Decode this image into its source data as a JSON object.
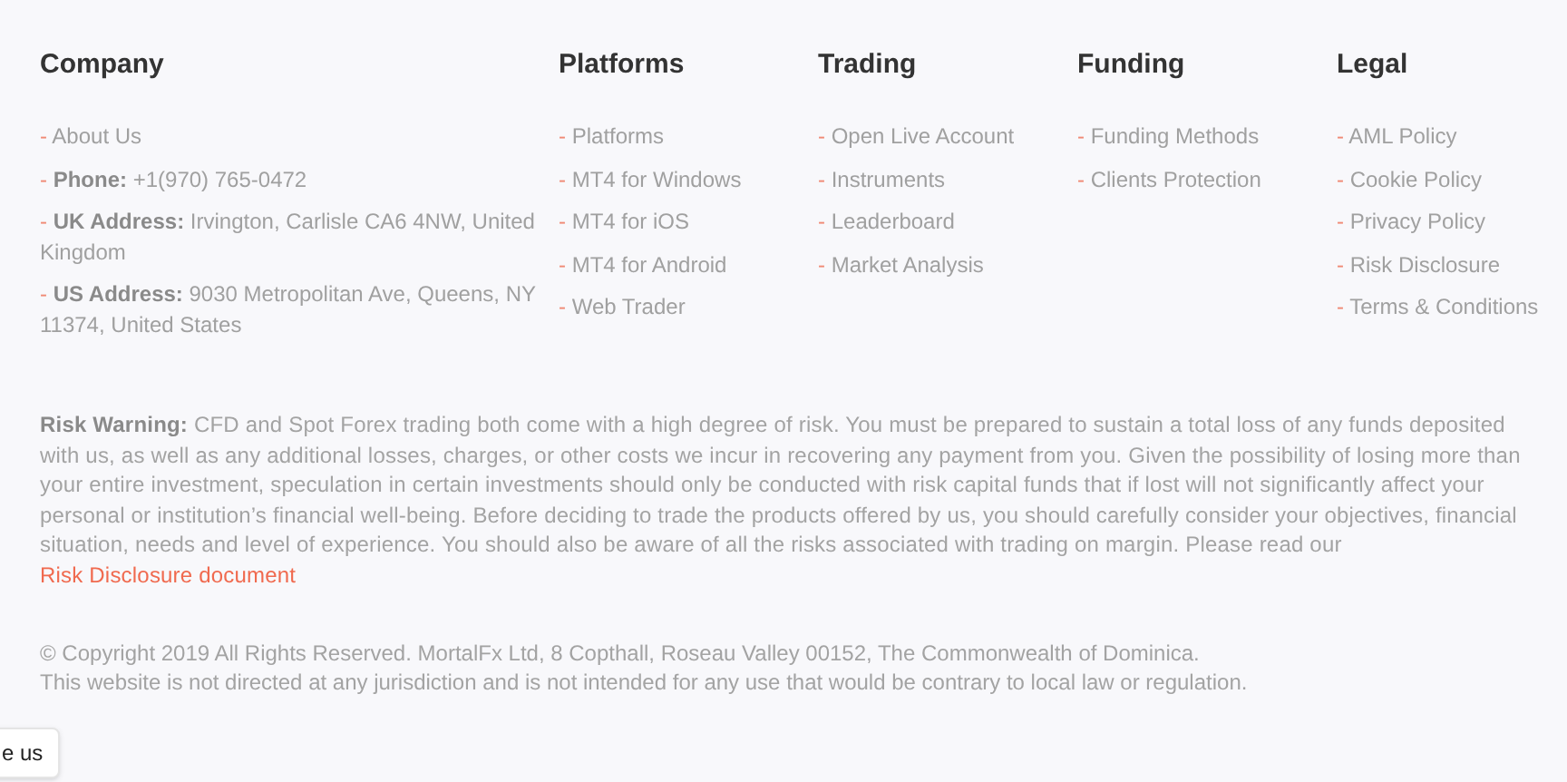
{
  "columns": [
    {
      "heading": "Company",
      "items": [
        {
          "marker": "-",
          "text": "About Us"
        },
        {
          "marker": "-",
          "text": "**Phone:** +1(970) 765-0472"
        },
        {
          "marker": "-",
          "text": "**UK Address:** Irvington, Carlisle CA6 4NW, United Kingdom"
        },
        {
          "marker": "-",
          "text": "**US Address:** 9030 Metropolitan Ave, Queens, NY 11374, United States"
        }
      ]
    },
    {
      "heading": "Platforms",
      "items": [
        {
          "marker": "-",
          "text": "Platforms"
        },
        {
          "marker": "-",
          "text": "MT4 for Windows"
        },
        {
          "marker": "-",
          "text": "MT4 for iOS"
        },
        {
          "marker": "-",
          "text": "MT4 for Android"
        },
        {
          "marker": "-",
          "text": "Web Trader"
        }
      ]
    },
    {
      "heading": "Trading",
      "items": [
        {
          "marker": "-",
          "text": "Open Live Account"
        },
        {
          "marker": "-",
          "text": "Instruments"
        },
        {
          "marker": "-",
          "text": "Leaderboard"
        },
        {
          "marker": "-",
          "text": "Market Analysis"
        }
      ]
    },
    {
      "heading": "Funding",
      "items": [
        {
          "marker": "-",
          "text": "Funding Methods"
        },
        {
          "marker": "-",
          "text": "Clients Protection"
        }
      ]
    },
    {
      "heading": "Legal",
      "items": [
        {
          "marker": "-",
          "text": "AML Policy"
        },
        {
          "marker": "-",
          "text": "Cookie Policy"
        },
        {
          "marker": "-",
          "text": "Privacy Policy"
        },
        {
          "marker": "-",
          "text": "Risk Disclosure"
        },
        {
          "marker": "-",
          "text": "Terms & Conditions"
        }
      ]
    }
  ],
  "risk_warning": {
    "text": "**Risk Warning:** CFD and Spot Forex trading both come with a high degree of risk. You must be prepared to sustain a total loss of any funds deposited with us, as well as any additional losses, charges, or other costs we incur in recovering any payment from you. Given the possibility of losing more than your entire investment, speculation in certain investments should only be conducted with risk capital funds that if lost will not significantly affect your personal or institution’s financial well-being. Before deciding to trade the products offered by us, you should carefully consider your objectives, financial situation, needs and level of experience. You should also be aware of all the risks associated with trading on margin. Please read our",
    "link": "Risk Disclosure document"
  },
  "copyright": [
    "© Copyright 2019 All Rights Reserved. MortalFx Ltd, 8 Copthall, Roseau Valley 00152, The Commonwealth of Dominica.",
    "This website is not directed at any jurisdiction and is not intended for any use that would be contrary to local law or regulation."
  ],
  "floating_button": {
    "label": "e us"
  }
}
